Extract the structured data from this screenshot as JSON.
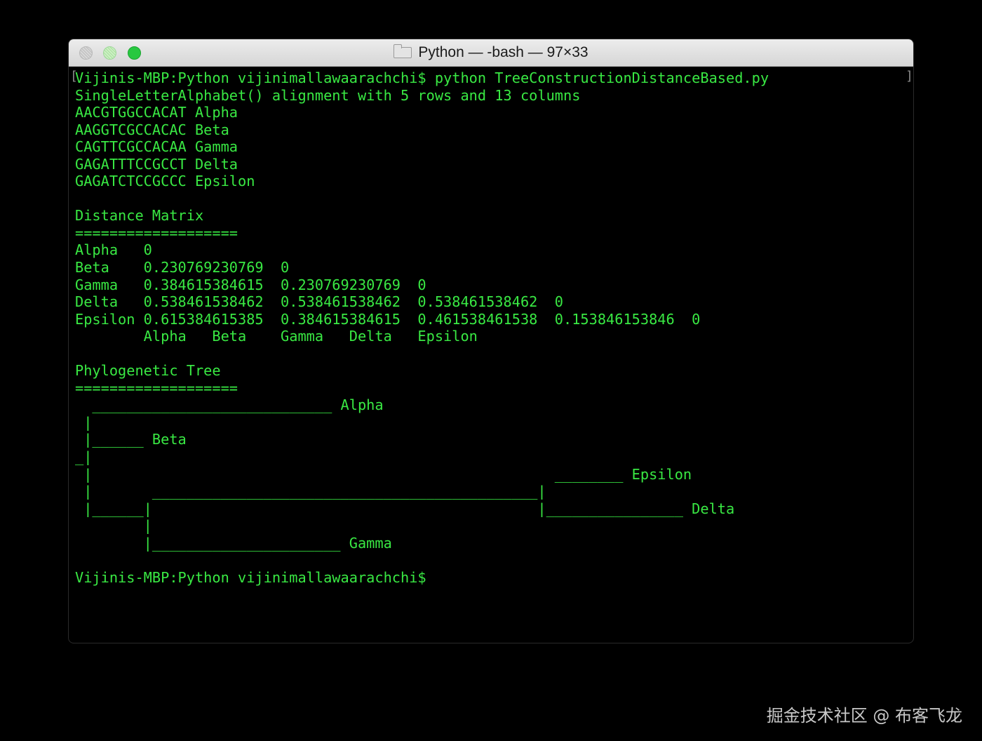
{
  "window": {
    "title": "Python — -bash — 97×33",
    "title_icon": "folder-icon",
    "buttons": [
      "close",
      "minimize",
      "zoom"
    ]
  },
  "terminal": {
    "text_color": "#39e843",
    "background": "#000000",
    "lines": [
      "Vijinis-MBP:Python vijinimallawaarachchi$ python TreeConstructionDistanceBased.py",
      "SingleLetterAlphabet() alignment with 5 rows and 13 columns",
      "AACGTGGCCACAT Alpha",
      "AAGGTCGCCACAC Beta",
      "CAGTTCGCCACAA Gamma",
      "GAGATTTCCGCCT Delta",
      "GAGATCTCCGCCC Epsilon",
      "",
      "Distance Matrix",
      "===================",
      "Alpha   0",
      "Beta    0.230769230769  0",
      "Gamma   0.384615384615  0.230769230769  0",
      "Delta   0.538461538462  0.538461538462  0.538461538462  0",
      "Epsilon 0.615384615385  0.384615384615  0.461538461538  0.153846153846  0",
      "        Alpha   Beta    Gamma   Delta   Epsilon",
      "",
      "Phylogenetic Tree",
      "===================",
      "  ____________________________ Alpha",
      " |",
      " |______ Beta",
      "_|",
      " |                                                      ________ Epsilon",
      " |       _____________________________________________|",
      " |______|                                             |________________ Delta",
      "        |",
      "        |______________________ Gamma",
      "",
      "Vijinis-MBP:Python vijinimallawaarachchi$"
    ]
  },
  "watermark": "掘金技术社区 @ 布客飞龙"
}
